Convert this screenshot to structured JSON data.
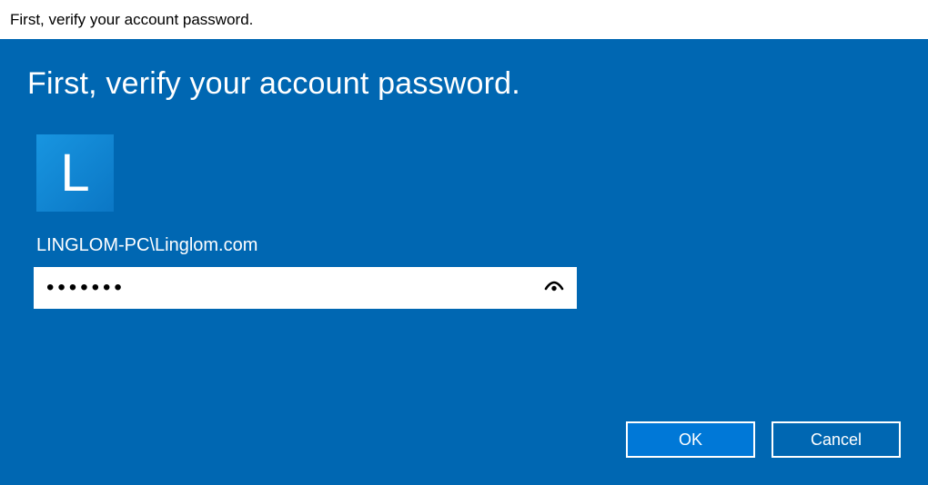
{
  "titlebar": {
    "text": "First, verify your account password."
  },
  "heading": "First, verify your account password.",
  "avatar": {
    "letter": "L"
  },
  "account_name": "LINGLOM-PC\\Linglom.com",
  "password": {
    "value": "•••••••"
  },
  "buttons": {
    "ok": "OK",
    "cancel": "Cancel"
  }
}
